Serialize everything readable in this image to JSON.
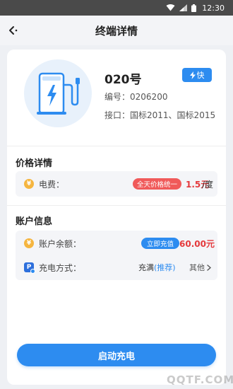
{
  "status_bar": {
    "time": "12:30"
  },
  "header": {
    "title": "终端详情"
  },
  "terminal": {
    "name": "020号",
    "badge": "快",
    "code_label": "编号：",
    "code": "0206200",
    "port_label": "接口：",
    "port": "国标2011、国标2015"
  },
  "price_section": {
    "title": "价格详情",
    "fee_label": "电费：",
    "tag": "全天价格统一",
    "price": "1.5元",
    "unit": "/度"
  },
  "account_section": {
    "title": "账户信息",
    "balance_label": "账户余额：",
    "recharge_button": "立即充值",
    "balance": "60.00元",
    "method_label": "充电方式：",
    "method_value": "充满",
    "method_recommend": "(推荐)",
    "other_label": "其他"
  },
  "start_button": "启动充电",
  "watermark": "QQTF.COM",
  "colors": {
    "accent": "#2d8cf0",
    "price": "#e4393c",
    "tag": "#f05a5a",
    "coin": "#f5b53f",
    "status_bar": "#4a4a4a"
  }
}
